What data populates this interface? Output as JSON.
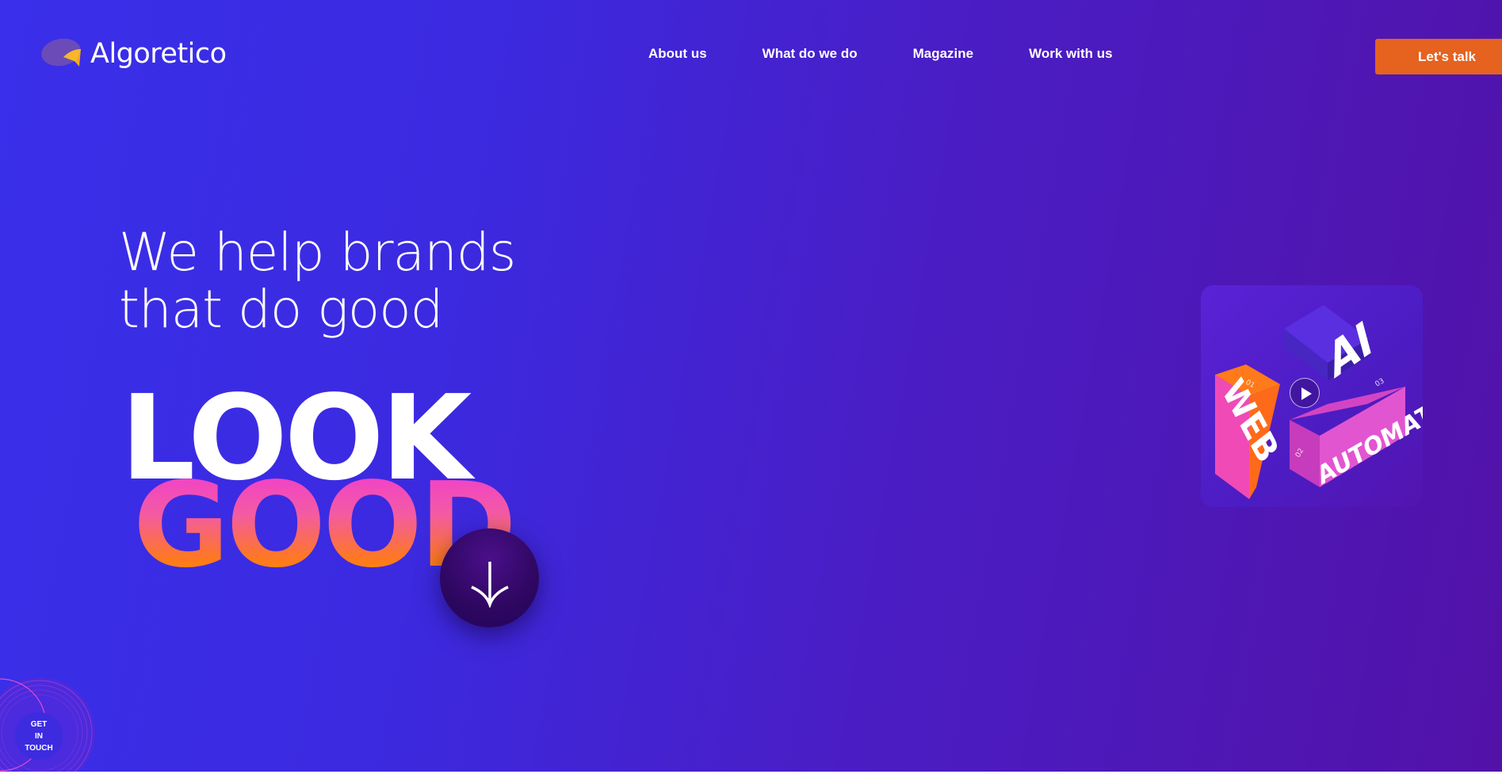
{
  "brand": {
    "name": "Algoretico"
  },
  "nav": {
    "items": [
      {
        "label": "About us"
      },
      {
        "label": "What do we do"
      },
      {
        "label": "Magazine"
      },
      {
        "label": "Work with us"
      }
    ],
    "cta_label": "Let's talk"
  },
  "hero": {
    "headline_line1": "We help brands",
    "headline_line2": "that do good",
    "big_word1": "LOOK",
    "big_word2": "GOOD"
  },
  "video_card": {
    "labels": [
      "WEB",
      "AI",
      "AUTOMATION"
    ],
    "numbers": [
      "01",
      "02",
      "03"
    ]
  },
  "get_in_touch": {
    "line1": "GET",
    "line2": "IN",
    "line3": "TOUCH"
  },
  "colors": {
    "accent_orange": "#e5621f",
    "bg_start": "#3a2fea",
    "bg_end": "#5212a8",
    "pink": "#f03cd0"
  },
  "icons": {
    "logo": "algoretico-logo-icon",
    "scroll": "arrow-down-icon",
    "play": "play-icon"
  }
}
